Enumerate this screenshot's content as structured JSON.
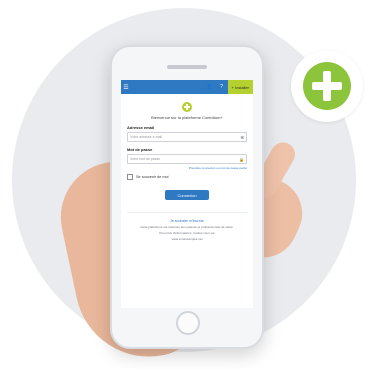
{
  "topbar": {
    "menu_icon": "☰",
    "user_icon": "👤",
    "help_icon": "?",
    "install_label": "+ Installer"
  },
  "login": {
    "welcome": "Bienvenue sur la plateforme Contrôlum+",
    "email_label": "Adresse email",
    "email_placeholder": "Votre adresse e-mail",
    "password_label": "Mot de passe",
    "password_placeholder": "Votre mot de passe",
    "forgot_link": "Première connexion ou mot de passe perdu",
    "remember_label": "Se souvenir de moi",
    "submit_label": "Connexion",
    "signup_link": "Je souhaite m'inscrire",
    "footer_text": "Cette plateforme est réservée aux patients et professionnels de santé.",
    "footer_info": "Pour plus d'informations, rendez-vous sur",
    "footer_url": "www.controlumplus.net"
  },
  "colors": {
    "accent_green": "#8cc43c",
    "primary_blue": "#2f78c2",
    "lime": "#b5d12f"
  }
}
